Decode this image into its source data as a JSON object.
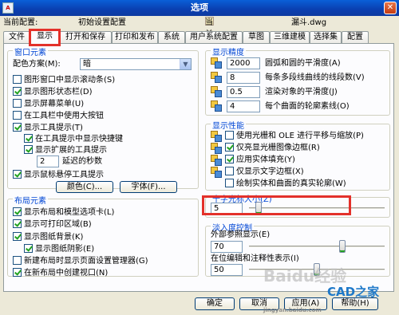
{
  "window": {
    "title": "选项",
    "icon_text": "A",
    "close_glyph": "✕"
  },
  "info": {
    "profile_label": "当前配置:",
    "profile_value": "初始设置配置",
    "drawing_label": "当前图形:",
    "drawing_value": "漏斗.dwg"
  },
  "tabs": [
    "文件",
    "显示",
    "打开和保存",
    "打印和发布",
    "系统",
    "用户系统配置",
    "草图",
    "三维建模",
    "选择集",
    "配置"
  ],
  "active_tab": "显示",
  "window_elements": {
    "title": "窗口元素",
    "scheme_label": "配色方案(M):",
    "scheme_value": "暗",
    "checkboxes": [
      {
        "label": "图形窗口中显示滚动条(S)",
        "checked": false
      },
      {
        "label": "显示图形状态栏(D)",
        "checked": true
      },
      {
        "label": "显示屏幕菜单(U)",
        "checked": false
      },
      {
        "label": "在工具栏中使用大按钮",
        "checked": false
      },
      {
        "label": "显示工具提示(T)",
        "checked": true
      },
      {
        "label": "在工具提示中显示快捷键",
        "checked": true
      },
      {
        "label": "显示扩展的工具提示",
        "checked": true
      }
    ],
    "delay_value": "2",
    "delay_label": "延迟的秒数",
    "rollover_label": "显示鼠标悬停工具提示",
    "rollover_checked": true,
    "colors_button": "颜色(C)...",
    "fonts_button": "字体(F)..."
  },
  "layout_elements": {
    "title": "布局元素",
    "checkboxes": [
      {
        "label": "显示布局和模型选项卡(L)",
        "checked": true
      },
      {
        "label": "显示可打印区域(B)",
        "checked": true
      },
      {
        "label": "显示图纸背景(K)",
        "checked": true
      },
      {
        "label": "显示图纸阴影(E)",
        "checked": true
      },
      {
        "label": "新建布局时显示页面设置管理器(G)",
        "checked": false
      },
      {
        "label": "在新布局中创建视口(N)",
        "checked": true
      }
    ]
  },
  "display_resolution": {
    "title": "显示精度",
    "items": [
      {
        "value": "2000",
        "label": "圆弧和圆的平滑度(A)"
      },
      {
        "value": "8",
        "label": "每条多段线曲线的线段数(V)"
      },
      {
        "value": "0.5",
        "label": "渲染对象的平滑度(J)"
      },
      {
        "value": "4",
        "label": "每个曲面的轮廓素线(O)"
      }
    ]
  },
  "display_performance": {
    "title": "显示性能",
    "checkboxes": [
      {
        "label": "使用光栅和 OLE 进行平移与缩放(P)",
        "checked": false
      },
      {
        "label": "仅亮显光栅图像边框(R)",
        "checked": true
      },
      {
        "label": "应用实体填充(Y)",
        "checked": true
      },
      {
        "label": "仅显示文字边框(X)",
        "checked": false
      },
      {
        "label": "绘制实体和曲面的真实轮廓(W)",
        "checked": false
      }
    ]
  },
  "crosshair": {
    "title": "十字光标大小(Z)",
    "value": "5",
    "slider_percent": 5
  },
  "fade_control": {
    "title": "淡入度控制",
    "xref_label": "外部参照显示(E)",
    "xref_value": "70",
    "xref_slider_percent": 70,
    "inplace_label": "在位编辑和注释性表示(I)",
    "inplace_value": "50",
    "inplace_slider_percent": 50
  },
  "bottom_buttons": {
    "ok": "确定",
    "cancel": "取消",
    "apply": "应用(A)",
    "help": "帮助(H)"
  },
  "watermarks": {
    "baidu": "Baidu经验",
    "cad": "CAD之家",
    "site": "jingyan.baidu.com"
  }
}
